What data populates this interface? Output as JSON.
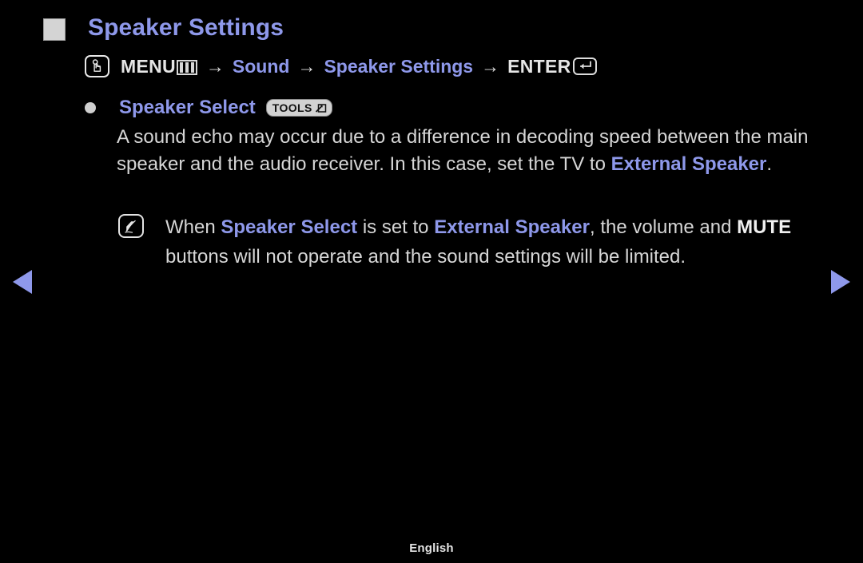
{
  "page": {
    "title": "Speaker Settings",
    "background_color": "#000000",
    "accent_color": "#8e98ea",
    "text_color": "#d6d6d6"
  },
  "menu_path": {
    "menu_icon_name": "hand-press-icon",
    "menu_label": "MENU",
    "menu_glyph_name": "menu-bars-icon",
    "separator": "→",
    "steps": [
      "Sound",
      "Speaker Settings"
    ],
    "enter_label": "ENTER",
    "enter_icon_name": "enter-return-icon"
  },
  "item": {
    "bullet_label": "Speaker Select",
    "tools_badge": "TOOLS",
    "tools_badge_icon_name": "tools-arrow-icon"
  },
  "body": {
    "segments": [
      {
        "text": "A sound echo may occur due to a difference in decoding speed between the main speaker and the audio receiver. In this case, set the TV to ",
        "style": "normal"
      },
      {
        "text": "External Speaker",
        "style": "accent-bold"
      },
      {
        "text": ".",
        "style": "normal"
      }
    ]
  },
  "note": {
    "icon_name": "note-pen-icon",
    "segments": [
      {
        "text": "When ",
        "style": "normal"
      },
      {
        "text": "Speaker Select",
        "style": "accent-bold"
      },
      {
        "text": " is set to ",
        "style": "normal"
      },
      {
        "text": "External Speaker",
        "style": "accent-bold"
      },
      {
        "text": ", the volume and ",
        "style": "normal"
      },
      {
        "text": "MUTE",
        "style": "white-bold"
      },
      {
        "text": " buttons will not operate and the sound settings will be limited.",
        "style": "normal"
      }
    ]
  },
  "navigation": {
    "prev_label": "◀",
    "next_label": "▶"
  },
  "footer": {
    "language": "English"
  }
}
